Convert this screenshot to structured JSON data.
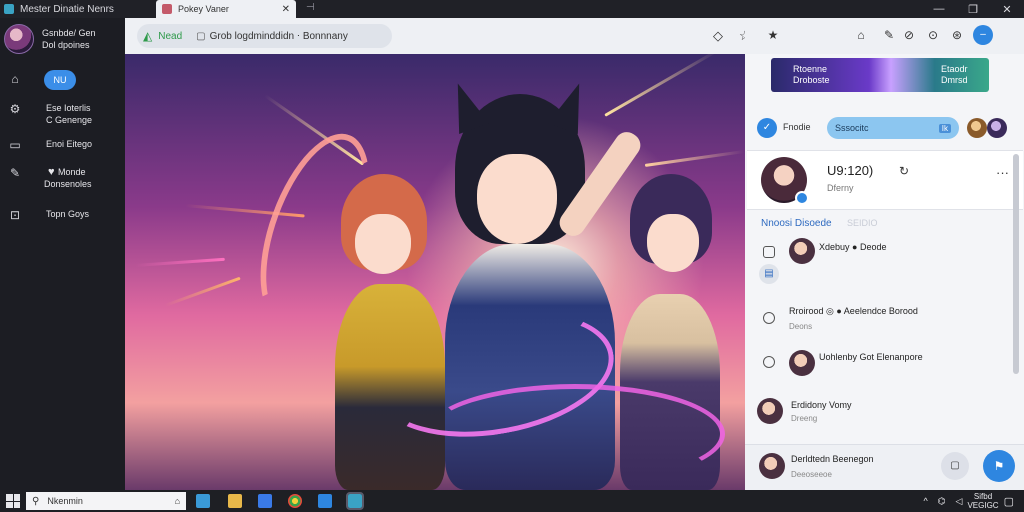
{
  "titlebar": {
    "app_title": "Mester Dinatie Nenrs",
    "tab_label": "Pokey Vaner",
    "tab_close": "✕",
    "new_tab": "⊣",
    "minimize": "—",
    "restore": "❐",
    "close": "✕"
  },
  "sidebar": {
    "profile_name": "Gsnbde/ Gen",
    "profile_sub": "Dol dpoines",
    "pill_label": "NU",
    "item1_a": "Ese Ioterlis",
    "item1_b": "C Genenge",
    "item2": "Enoi Eitego",
    "item3_a": "Monde",
    "item3_b": "Donsenoles",
    "item4": "Topn Goys"
  },
  "navbar": {
    "site": "Nead",
    "doc_icon": "▢",
    "path": "Grob logdminddidn ⋅ Bonnnany",
    "btn1": "◇",
    "btn2": "☆",
    "btn3": "★"
  },
  "rpanel": {
    "top_icons": [
      "⌂",
      "✎",
      "⊘",
      "⊙",
      "⊛"
    ],
    "top_blue": "–",
    "banner_left_a": "Rtoenne",
    "banner_left_b": "Droboste",
    "banner_right_a": "Etaodr",
    "banner_right_b": "Dmrsd",
    "tool_label": "Fnodie",
    "search_text": "Sssocitc",
    "search_key": "Ik",
    "card_title": "U9:120)",
    "card_sub": "Dferny",
    "card_menu": "···",
    "section_title": "Nnoosi Disoede",
    "section_count": "SEIDIO",
    "items": [
      {
        "name": "Xdebuy ● Deode",
        "sub": ""
      },
      {
        "name": "Rroirood ◎ ● Aeelendce Borood",
        "sub": "Deons"
      },
      {
        "name": "Uohlenby Got Elenanpore",
        "sub": ""
      },
      {
        "name": "Erdidony Vomy",
        "sub": "Dreeng"
      }
    ],
    "bottom_name": "Derldtedn Beenegon",
    "bottom_sub": "Deeoseeoe",
    "bottom_sq": "▢",
    "bottom_send": "⚑"
  },
  "taskbar": {
    "search_text": "Nkenmin",
    "search_icon2": "⌂",
    "tray_chevron": "^",
    "tray_net": "⌬",
    "tray_vol": "◁",
    "clock_time": "Sifbd",
    "clock_date": "VEGIGC",
    "notif": "▢"
  },
  "colors": {
    "accent": "#2e86e0",
    "sidebar_bg": "#1c1d23",
    "panel_bg": "#f4f5f8"
  }
}
